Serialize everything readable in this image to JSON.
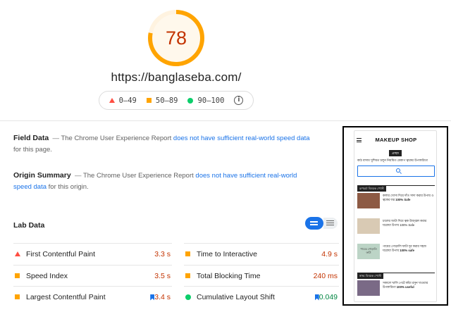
{
  "score": {
    "value": "78",
    "fraction": 0.78,
    "ring_color": "#ffa400",
    "text_color": "#c33300",
    "track_color": "#fff3e0"
  },
  "url": "https://banglaseba.com/",
  "legend": [
    {
      "label": "0–49",
      "shape": "triangle",
      "color": "#ff4e42"
    },
    {
      "label": "50–89",
      "shape": "square",
      "color": "#ffa400"
    },
    {
      "label": "90–100",
      "shape": "circle",
      "color": "#0cce6b"
    }
  ],
  "field_data": {
    "title": "Field Data",
    "dash": "—",
    "text_before": "The Chrome User Experience Report",
    "link": "does not have sufficient real-world speed data",
    "text_after": "for this page."
  },
  "origin_summary": {
    "title": "Origin Summary",
    "dash": "—",
    "text_before": "The Chrome User Experience Report",
    "link": "does not have sufficient real-world speed data",
    "text_after": "for this origin."
  },
  "lab_data": {
    "title": "Lab Data",
    "metrics_left": [
      {
        "label": "First Contentful Paint",
        "value": "3.3 s",
        "status": "fail",
        "flag": false
      },
      {
        "label": "Speed Index",
        "value": "3.5 s",
        "status": "average",
        "flag": false
      },
      {
        "label": "Largest Contentful Paint",
        "value": "3.4 s",
        "status": "average",
        "flag": true
      }
    ],
    "metrics_right": [
      {
        "label": "Time to Interactive",
        "value": "4.9 s",
        "status": "average",
        "flag": false
      },
      {
        "label": "Total Blocking Time",
        "value": "240 ms",
        "status": "average",
        "flag": false
      },
      {
        "label": "Cumulative Layout Shift",
        "value": "0.049",
        "status": "pass",
        "flag": true
      }
    ]
  },
  "phone": {
    "site_title": "MAKEUP SHOP",
    "tag": "প্রচ্ছদ",
    "ticker": "কাঠ বাদাম খুশিমত চলুন নিয়মিত মেকাপ ত্বকের উপকারিতা",
    "section1": "রূপচর্চা বিষয়ক পোস্ট",
    "section2": "স্বাস্থ্য বিষয়ক পোস্ট",
    "items": [
      {
        "title": "কলার খোসা দিয়ে দাঁত সাদা করার উপায় ও ত্বকের যত্ন",
        "badge": "100% Safe",
        "thumb": "#8d5a44"
      },
      {
        "title": "চালের আটা দিয়ে ত্বক উজ্জ্বল করার ঘরোয়া উপায় 100% Safe",
        "badge": "",
        "thumb": "#d9cab4"
      },
      {
        "title": "পায়ের গোড়ালি ফাটা দূর করার সহজ ঘরোয়া উপায়",
        "badge": "100% safe",
        "thumb": "#bcd4c6"
      },
      {
        "title": "সকালে খালি পেটে কাঁচা রসুন খাওয়ার উপকারিতা",
        "badge": "100% useful",
        "thumb": "#7a6a86"
      }
    ],
    "thumb_caption": "পায়ের গোড়ালি ফাটা"
  }
}
